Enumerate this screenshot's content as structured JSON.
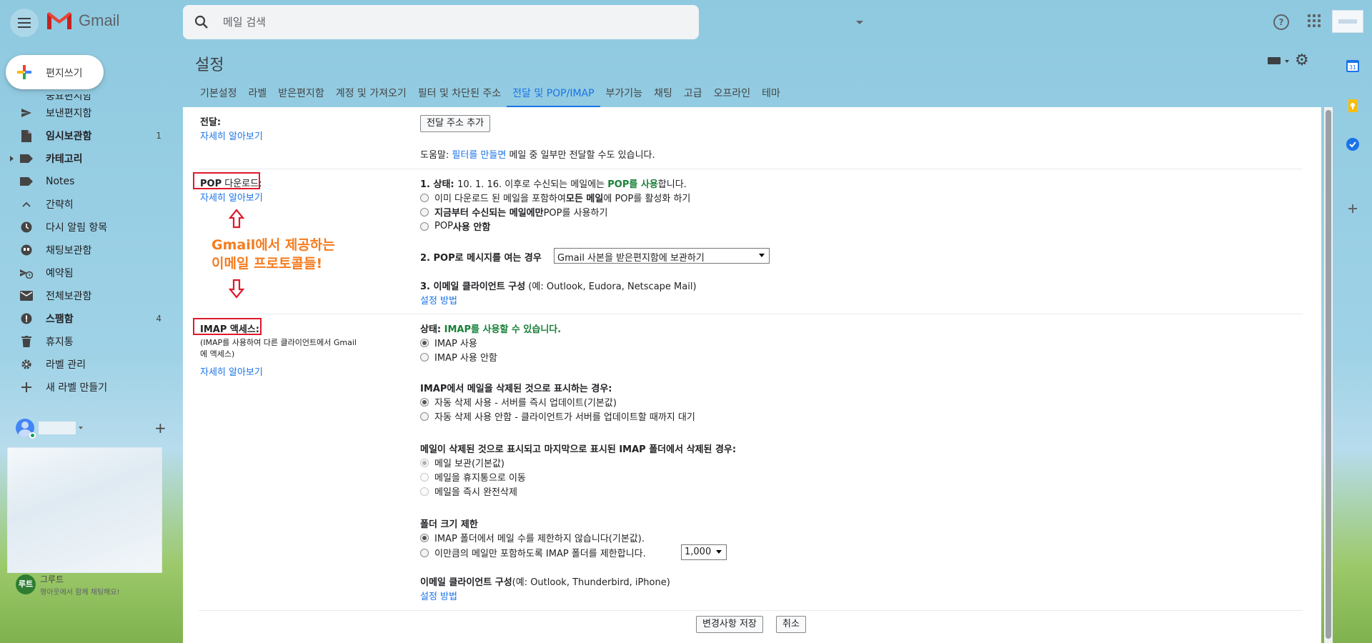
{
  "app": {
    "name": "Gmail"
  },
  "search": {
    "placeholder": "메일 검색"
  },
  "compose": {
    "label": "편지쓰기"
  },
  "sidebar": {
    "items": [
      {
        "label": "중요편지함",
        "count": "",
        "bold": false,
        "icon": "important-icon"
      },
      {
        "label": "보낸편지함",
        "count": "",
        "bold": false,
        "icon": "send-icon"
      },
      {
        "label": "임시보관함",
        "count": "1",
        "bold": true,
        "icon": "draft-icon"
      },
      {
        "label": "카테고리",
        "count": "",
        "bold": true,
        "icon": "label-icon"
      },
      {
        "label": "Notes",
        "count": "",
        "bold": false,
        "icon": "label-icon"
      },
      {
        "label": "간략히",
        "count": "",
        "bold": false,
        "icon": "chevron-up-icon"
      },
      {
        "label": "다시 알림 항목",
        "count": "",
        "bold": false,
        "icon": "clock-icon"
      },
      {
        "label": "채팅보관함",
        "count": "",
        "bold": false,
        "icon": "chat-icon"
      },
      {
        "label": "예약됨",
        "count": "",
        "bold": false,
        "icon": "scheduled-icon"
      },
      {
        "label": "전체보관함",
        "count": "",
        "bold": false,
        "icon": "mail-icon"
      },
      {
        "label": "스팸함",
        "count": "4",
        "bold": true,
        "icon": "spam-icon"
      },
      {
        "label": "휴지통",
        "count": "",
        "bold": false,
        "icon": "trash-icon"
      },
      {
        "label": "라벨 관리",
        "count": "",
        "bold": false,
        "icon": "gear-icon"
      },
      {
        "label": "새 라벨 만들기",
        "count": "",
        "bold": false,
        "icon": "plus-icon"
      }
    ]
  },
  "hangouts": {
    "contact_initials": "루트",
    "contact_name": "그루트",
    "contact_sub": "행아웃에서 함께 채팅해요!"
  },
  "page": {
    "title": "설정"
  },
  "tabs": [
    {
      "label": "기본설정",
      "active": false
    },
    {
      "label": "라벨",
      "active": false
    },
    {
      "label": "받은편지함",
      "active": false
    },
    {
      "label": "계정 및 가져오기",
      "active": false
    },
    {
      "label": "필터 및 차단된 주소",
      "active": false
    },
    {
      "label": "전달 및 POP/IMAP",
      "active": true
    },
    {
      "label": "부가기능",
      "active": false
    },
    {
      "label": "채팅",
      "active": false
    },
    {
      "label": "고급",
      "active": false
    },
    {
      "label": "오프라인",
      "active": false
    },
    {
      "label": "테마",
      "active": false
    }
  ],
  "forwarding": {
    "title": "전달:",
    "learn_more": "자세히 알아보기",
    "add_button": "전달 주소 추가",
    "tip_prefix": "도움말: ",
    "tip_link": "필터를 만들면",
    "tip_suffix": " 메일 중 일부만 전달할 수도 있습니다."
  },
  "pop": {
    "title_bold": "POP",
    "title_rest": " 다운로드:",
    "learn_more": "자세히 알아보기",
    "status_label": "1. 상태: ",
    "status_text": "10. 1. 16. 이후로 수신되는 메일에는 ",
    "status_green": "POP를 사용",
    "status_end": "합니다.",
    "options": [
      {
        "pre": "이미 다운로드 된 메일을 포함하여 ",
        "bold": "모든 메일",
        "post": "에 POP를 활성화 하기",
        "checked": false
      },
      {
        "pre": "",
        "bold": "지금부터 수신되는 메일에만",
        "post": " POP를 사용하기",
        "checked": false
      },
      {
        "pre": "POP ",
        "bold": "사용 안함",
        "post": "",
        "checked": false
      }
    ],
    "q2_label": "2. POP로 메시지를 여는 경우",
    "q2_select": "Gmail 사본을 받은편지함에 보관하기",
    "q3_label": "3. 이메일 클라이언트 구성",
    "q3_hint": " (예: Outlook, Eudora, Netscape Mail)",
    "setup_link": "설정 방법"
  },
  "annotation": {
    "line1": "Gmail에서 제공하는",
    "line2": "이메일 프로토콜들!"
  },
  "imap": {
    "title": "IMAP 액세스:",
    "desc": "(IMAP를 사용하여 다른 클라이언트에서 Gmail에 액세스)",
    "learn_more": "자세히 알아보기",
    "status_label": "상태: ",
    "status_green": "IMAP를 사용할 수 있습니다.",
    "enable_options": [
      {
        "label": "IMAP 사용",
        "checked": true
      },
      {
        "label": "IMAP 사용 안함",
        "checked": false
      }
    ],
    "deleted_title": "IMAP에서 메일을 삭제된 것으로 표시하는 경우:",
    "deleted_options": [
      {
        "label": "자동 삭제 사용 - 서버를 즉시 업데이트(기본값)",
        "checked": true
      },
      {
        "label": "자동 삭제 사용 안함 - 클라이언트가 서버를 업데이트할 때까지 대기",
        "checked": false
      }
    ],
    "expunge_title": "메일이 삭제된 것으로 표시되고 마지막으로 표시된 IMAP 폴더에서 삭제된 경우:",
    "expunge_options": [
      {
        "label": "메일 보관(기본값)",
        "checked": true
      },
      {
        "label": "메일을 휴지통으로 이동",
        "checked": false
      },
      {
        "label": "메일을 즉시 완전삭제",
        "checked": false
      }
    ],
    "folder_title": "폴더 크기 제한",
    "folder_options": [
      {
        "label": "IMAP 폴더에서 메일 수를 제한하지 않습니다(기본값).",
        "checked": true
      },
      {
        "label": "이만큼의 메일만 포함하도록 IMAP 폴더를 제한합니다.",
        "checked": false
      }
    ],
    "folder_select": "1,000",
    "client_title": "이메일 클라이언트 구성",
    "client_hint": "(예: Outlook, Thunderbird, iPhone)",
    "setup_link": "설정 방법"
  },
  "footer": {
    "save": "변경사항 저장",
    "cancel": "취소"
  },
  "colors": {
    "accent": "#1a73e8",
    "green": "#188038",
    "annotation": "#f57c1f",
    "highlight": "#e0192d"
  }
}
